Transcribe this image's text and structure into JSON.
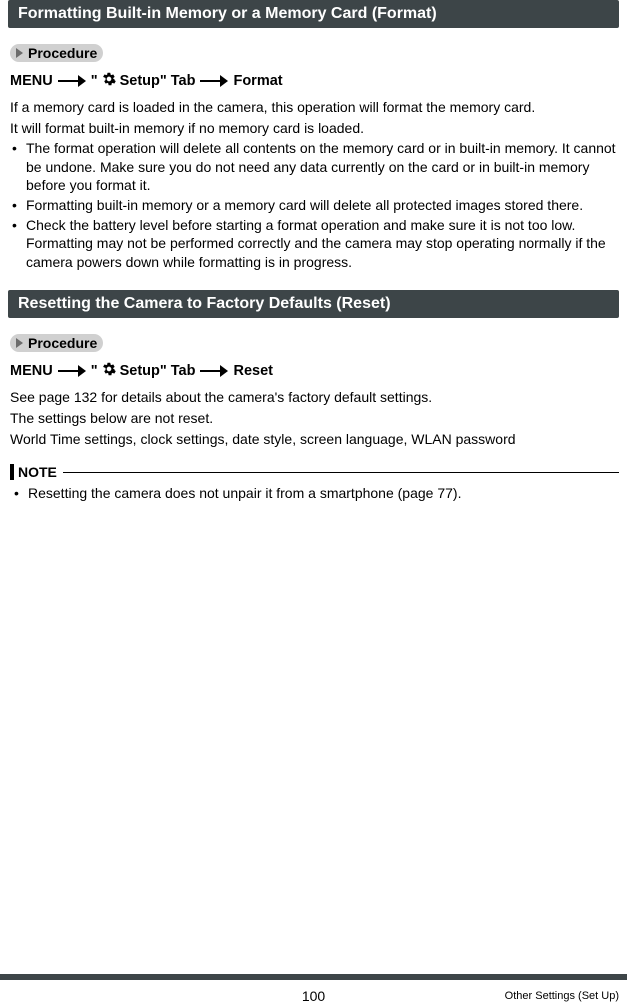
{
  "sections": [
    {
      "title": "Formatting Built-in Memory or a Memory Card (Format)",
      "procedure_label": "Procedure",
      "menu_path": {
        "start": "MENU",
        "quoted_prefix": "\"",
        "setup_word": " Setup\" Tab",
        "end": "Format"
      },
      "intro1": "If a memory card is loaded in the camera, this operation will format the memory card.",
      "intro2": "It will format built-in memory if no memory card is loaded.",
      "bullets": [
        "The format operation will delete all contents on the memory card or in built-in memory. It cannot be undone. Make sure you do not need any data currently on the card or in built-in memory before you format it.",
        "Formatting built-in memory or a memory card will delete all protected images stored there.",
        "Check the battery level before starting a format operation and make sure it is not too low. Formatting may not be performed correctly and the camera may stop operating normally if the camera powers down while formatting is in progress."
      ]
    },
    {
      "title": "Resetting the Camera to Factory Defaults (Reset)",
      "procedure_label": "Procedure",
      "menu_path": {
        "start": "MENU",
        "quoted_prefix": "\"",
        "setup_word": " Setup\" Tab",
        "end": "Reset"
      },
      "lines": [
        "See page 132 for details about the camera's factory default settings.",
        "The settings below are not reset.",
        "World Time settings, clock settings, date style, screen language, WLAN password"
      ],
      "note_label": "NOTE",
      "note_bullets": [
        "Resetting the camera does not unpair it from a smartphone (page 77)."
      ]
    }
  ],
  "footer": {
    "page_number": "100",
    "section_name": "Other Settings (Set Up)"
  }
}
